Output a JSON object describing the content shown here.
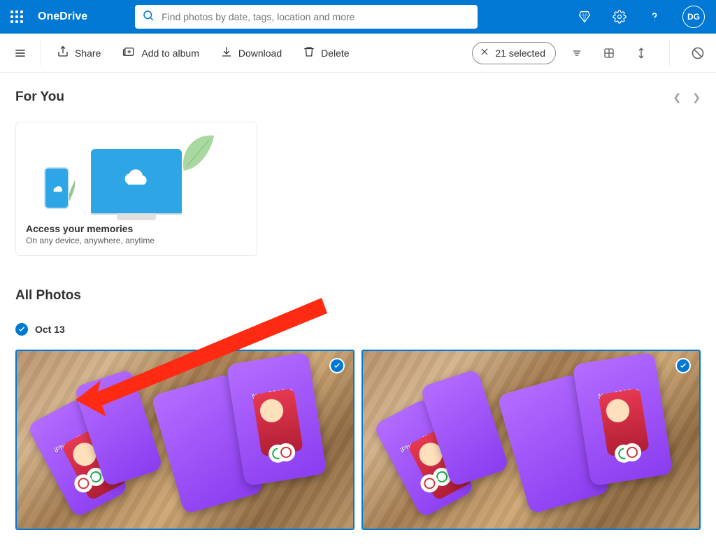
{
  "header": {
    "brand": "OneDrive",
    "search_placeholder": "Find photos by date, tags, location and more",
    "avatar_initials": "DG"
  },
  "commands": {
    "share": "Share",
    "add_to_album": "Add to album",
    "download": "Download",
    "delete": "Delete",
    "selected_label": "21 selected"
  },
  "foryou": {
    "heading": "For You",
    "card_title": "Access your memories",
    "card_subtitle": "On any device, anywhere, anytime"
  },
  "allphotos": {
    "heading": "All Photos",
    "date_label": "Oct 13",
    "photo_labels": {
      "flip": "iPhone_Xe",
      "fold": "Note 20 Ultra"
    }
  }
}
